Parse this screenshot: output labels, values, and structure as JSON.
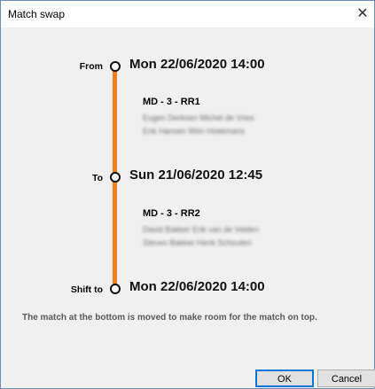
{
  "window": {
    "title": "Match swap",
    "close_glyph": "✕"
  },
  "timeline": {
    "accent_color": "#f07f1c",
    "from": {
      "label": "From",
      "datetime": "Mon 22/06/2020 14:00"
    },
    "match1": {
      "title": "MD - 3 - RR1",
      "line1": "Eugen Derksen Michel de Vries",
      "line2": "Erik Hansen Wim Hoekmans"
    },
    "to": {
      "label": "To",
      "datetime": "Sun 21/06/2020 12:45"
    },
    "match2": {
      "title": "MD - 3 - RR2",
      "line1": "David Bakker Erik van de Velden",
      "line2": "Steven Bakker Henk Schouten"
    },
    "shift_to": {
      "label": "Shift to",
      "datetime": "Mon 22/06/2020 14:00"
    }
  },
  "info_text": "The match at the bottom is moved to make room for the match on top.",
  "buttons": {
    "ok": "OK",
    "cancel": "Cancel"
  }
}
